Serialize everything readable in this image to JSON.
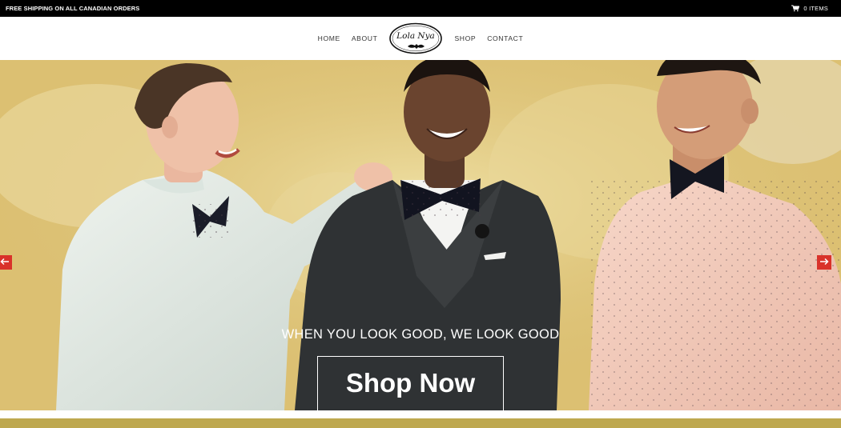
{
  "topbar": {
    "promo": "FREE SHIPPING ON ALL CANADIAN ORDERS",
    "cart_icon": "shopping-cart-icon",
    "cart_label": "0 ITEMS"
  },
  "nav": {
    "home": "HOME",
    "about": "ABOUT",
    "logo_text": "Lola Nya",
    "shop": "SHOP",
    "contact": "CONTACT"
  },
  "hero": {
    "tagline": "WHEN YOU LOOK GOOD, WE LOOK GOOD",
    "cta": "Shop Now",
    "prev_icon": "arrow-left-icon",
    "next_icon": "arrow-right-icon",
    "image": "three-men-in-bow-ties-laughing"
  },
  "colors": {
    "topbar_bg": "#000000",
    "arrow_bg": "#d9322a",
    "backdrop": "#e0c676",
    "footer_strip": "#bea84f"
  }
}
